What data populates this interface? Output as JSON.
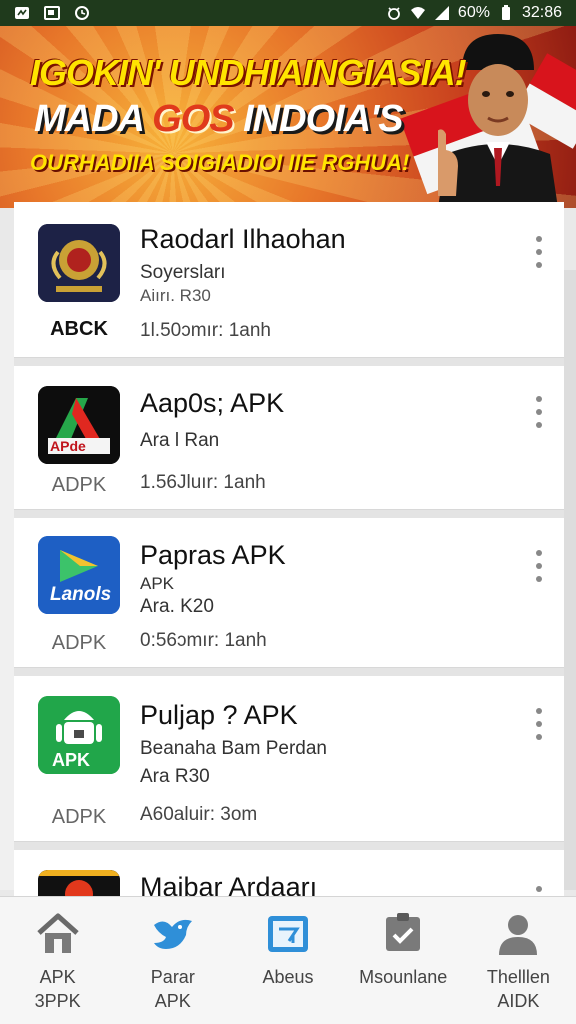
{
  "status_bar": {
    "battery_text": "60%",
    "time": "32:86",
    "icons": [
      "notification-icon",
      "image-icon",
      "sync-icon",
      "alarm-icon",
      "wifi-icon",
      "signal-icon",
      "battery-icon"
    ]
  },
  "banner": {
    "line1": "IGOKIN' UNDHIAINGIASIA!",
    "line2_a": "MADA ",
    "line2_b": "GOS",
    "line2_c": " INDOIA'S",
    "line3": "OURHADIIA SOIGIADIOI IIE RGHUA!"
  },
  "apps": [
    {
      "title": "Raodarl Ilhaohan",
      "sub1": "Soyersları",
      "sub2": "Aiırı. R30",
      "tag": "ABCK",
      "meta": "1l.50ɔmır: 1anh"
    },
    {
      "title": "Aap0s; APK",
      "sub1": "Ara l Ran",
      "sub2": "",
      "tag": "ADPK",
      "meta": "1.56Jluır: 1anh"
    },
    {
      "title": "Papras APK",
      "sub1": "APK",
      "sub2": "Ara. K20",
      "tag": "ADPK",
      "meta": "0:56ɔmır: 1anh"
    },
    {
      "title": "Puljap ? APK",
      "sub1": "Beanaha Bam Perdan",
      "sub2": "Ara R30",
      "tag": "ADPK",
      "meta": "A60aluir: 3om"
    },
    {
      "title": "Maibar Ardaarı",
      "sub1": "",
      "sub2": "",
      "tag": "",
      "meta": ""
    }
  ],
  "app_icon_labels": {
    "icon2": "APde",
    "icon3": "Lanols",
    "icon4": "APK"
  },
  "nav": [
    {
      "label": "APK\n3PPK",
      "icon": "home-icon"
    },
    {
      "label": "Parar\nAPK",
      "icon": "bird-icon"
    },
    {
      "label": "Abeus",
      "icon": "tablet-icon"
    },
    {
      "label": "Msounlane",
      "icon": "checklist-icon"
    },
    {
      "label": "Thelllen\nAIDK",
      "icon": "person-icon"
    }
  ],
  "colors": {
    "status_bar": "#1f3a1c",
    "banner_yellow": "#ffe400",
    "banner_red": "#d8141c",
    "nav_active_blue": "#2f8fd8"
  }
}
